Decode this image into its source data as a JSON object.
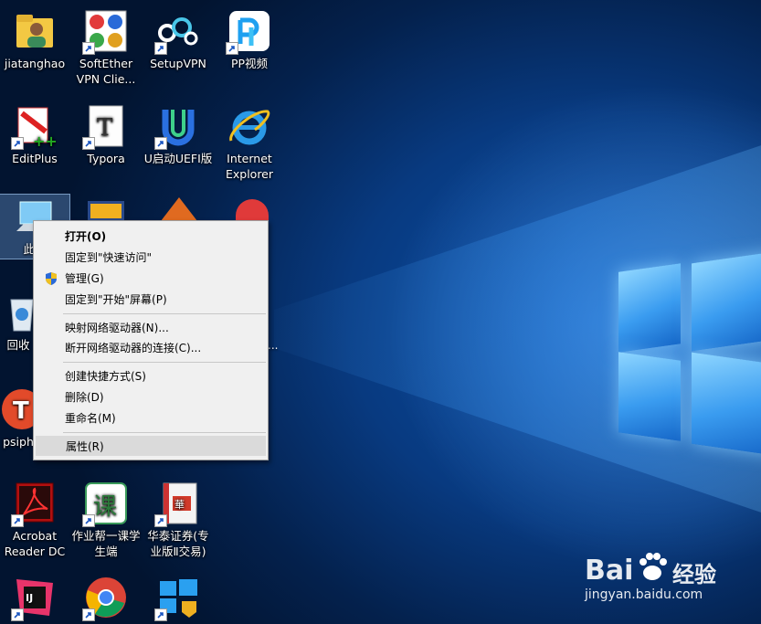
{
  "desktop": {
    "icons": [
      {
        "id": "jiatanghao",
        "label": "jiatanghao"
      },
      {
        "id": "softether",
        "label": "SoftEther\nVPN Clie..."
      },
      {
        "id": "setupvpn",
        "label": "SetupVPN"
      },
      {
        "id": "pp",
        "label": "PP视频"
      },
      {
        "id": "editplus",
        "label": "EditPlus"
      },
      {
        "id": "typora",
        "label": "Typora"
      },
      {
        "id": "uqidong",
        "label": "U启动UEFI版"
      },
      {
        "id": "ie",
        "label": "Internet\nExplorer"
      },
      {
        "id": "thispc",
        "label": "此电"
      },
      {
        "id": "recycle",
        "label": "回收"
      },
      {
        "id": "psiphon",
        "label": "psiph"
      },
      {
        "id": "hidden_ellipsis",
        "label": "..."
      },
      {
        "id": "acrobat",
        "label": "Acrobat\nReader DC"
      },
      {
        "id": "zuoyebang",
        "label": "作业帮一课学\n生端"
      },
      {
        "id": "huatai",
        "label": "华泰证券(专\n业版Ⅱ交易)"
      },
      {
        "id": "intellij",
        "label": ""
      },
      {
        "id": "chrome",
        "label": ""
      },
      {
        "id": "winupdate",
        "label": ""
      }
    ]
  },
  "context_menu": {
    "items": [
      {
        "label": "打开(O)",
        "bold": true
      },
      {
        "label": "固定到\"快速访问\""
      },
      {
        "label": "管理(G)",
        "icon": "shield-icon"
      },
      {
        "label": "固定到\"开始\"屏幕(P)"
      },
      {
        "label": "映射网络驱动器(N)..."
      },
      {
        "label": "断开网络驱动器的连接(C)..."
      },
      {
        "label": "创建快捷方式(S)"
      },
      {
        "label": "删除(D)"
      },
      {
        "label": "重命名(M)"
      },
      {
        "label": "属性(R)",
        "hover": true
      }
    ]
  },
  "watermark": {
    "brand_left": "Bai",
    "brand_right": "经验",
    "url": "jingyan.baidu.com"
  },
  "colors": {
    "desktop": "#0a4a9e",
    "menu_bg": "#f0f0f0",
    "menu_hover": "#dadada"
  }
}
